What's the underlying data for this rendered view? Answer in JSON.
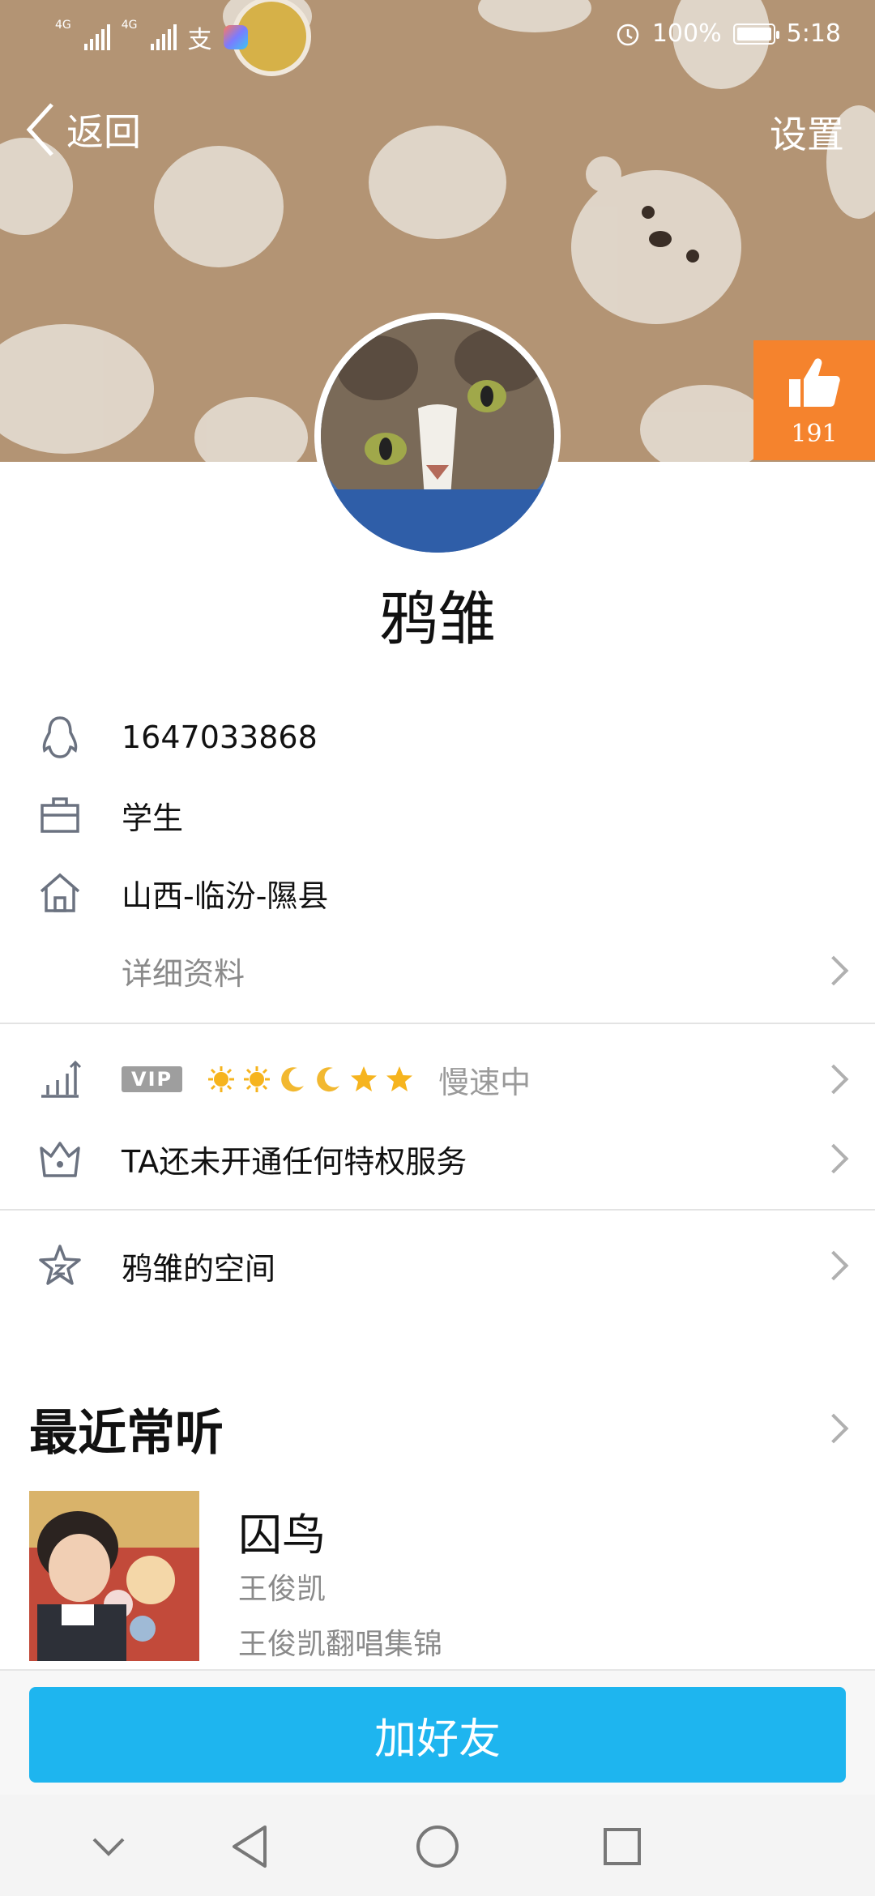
{
  "status_bar": {
    "network_1": "4G",
    "network_2": "4G",
    "battery": "100%",
    "time": "5:18"
  },
  "header": {
    "back_label": "返回",
    "settings_label": "设置",
    "like_count": "191"
  },
  "profile": {
    "nickname": "鸦雏",
    "qq_number": "1647033868",
    "occupation": "学生",
    "hometown": "山西-临汾-隰县",
    "details_link": "详细资料"
  },
  "level": {
    "vip_badge": "VIP",
    "level_icons": [
      "sun",
      "sun",
      "moon",
      "moon",
      "star",
      "star"
    ],
    "speed_text": "慢速中"
  },
  "privilege": {
    "text": "TA还未开通任何特权服务"
  },
  "space": {
    "label": "鸦雏的空间"
  },
  "recent": {
    "title": "最近常听",
    "songs": [
      {
        "name": "囚鸟",
        "artist": "王俊凯",
        "album": "王俊凯翻唱集锦"
      }
    ]
  },
  "actions": {
    "add_friend": "加好友"
  },
  "colors": {
    "header_bg": "#b39474",
    "like_bg": "#f5832d",
    "primary_button": "#1eb5ef"
  }
}
